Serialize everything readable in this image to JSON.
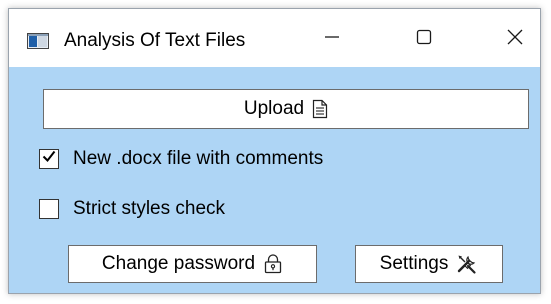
{
  "window": {
    "title": "Analysis Of Text Files",
    "controls": {
      "minimize": "minimize-icon",
      "maximize": "maximize-icon",
      "close": "close-icon"
    },
    "content_background": "#aed5f5"
  },
  "main": {
    "upload_button": {
      "label": "Upload",
      "icon": "document-icon"
    },
    "checkboxes": [
      {
        "label": "New .docx file with comments",
        "checked": true
      },
      {
        "label": "Strict styles check",
        "checked": false
      }
    ],
    "change_password_button": {
      "label": "Change password",
      "icon": "lock-icon"
    },
    "settings_button": {
      "label": "Settings",
      "icon": "tools-icon"
    }
  }
}
